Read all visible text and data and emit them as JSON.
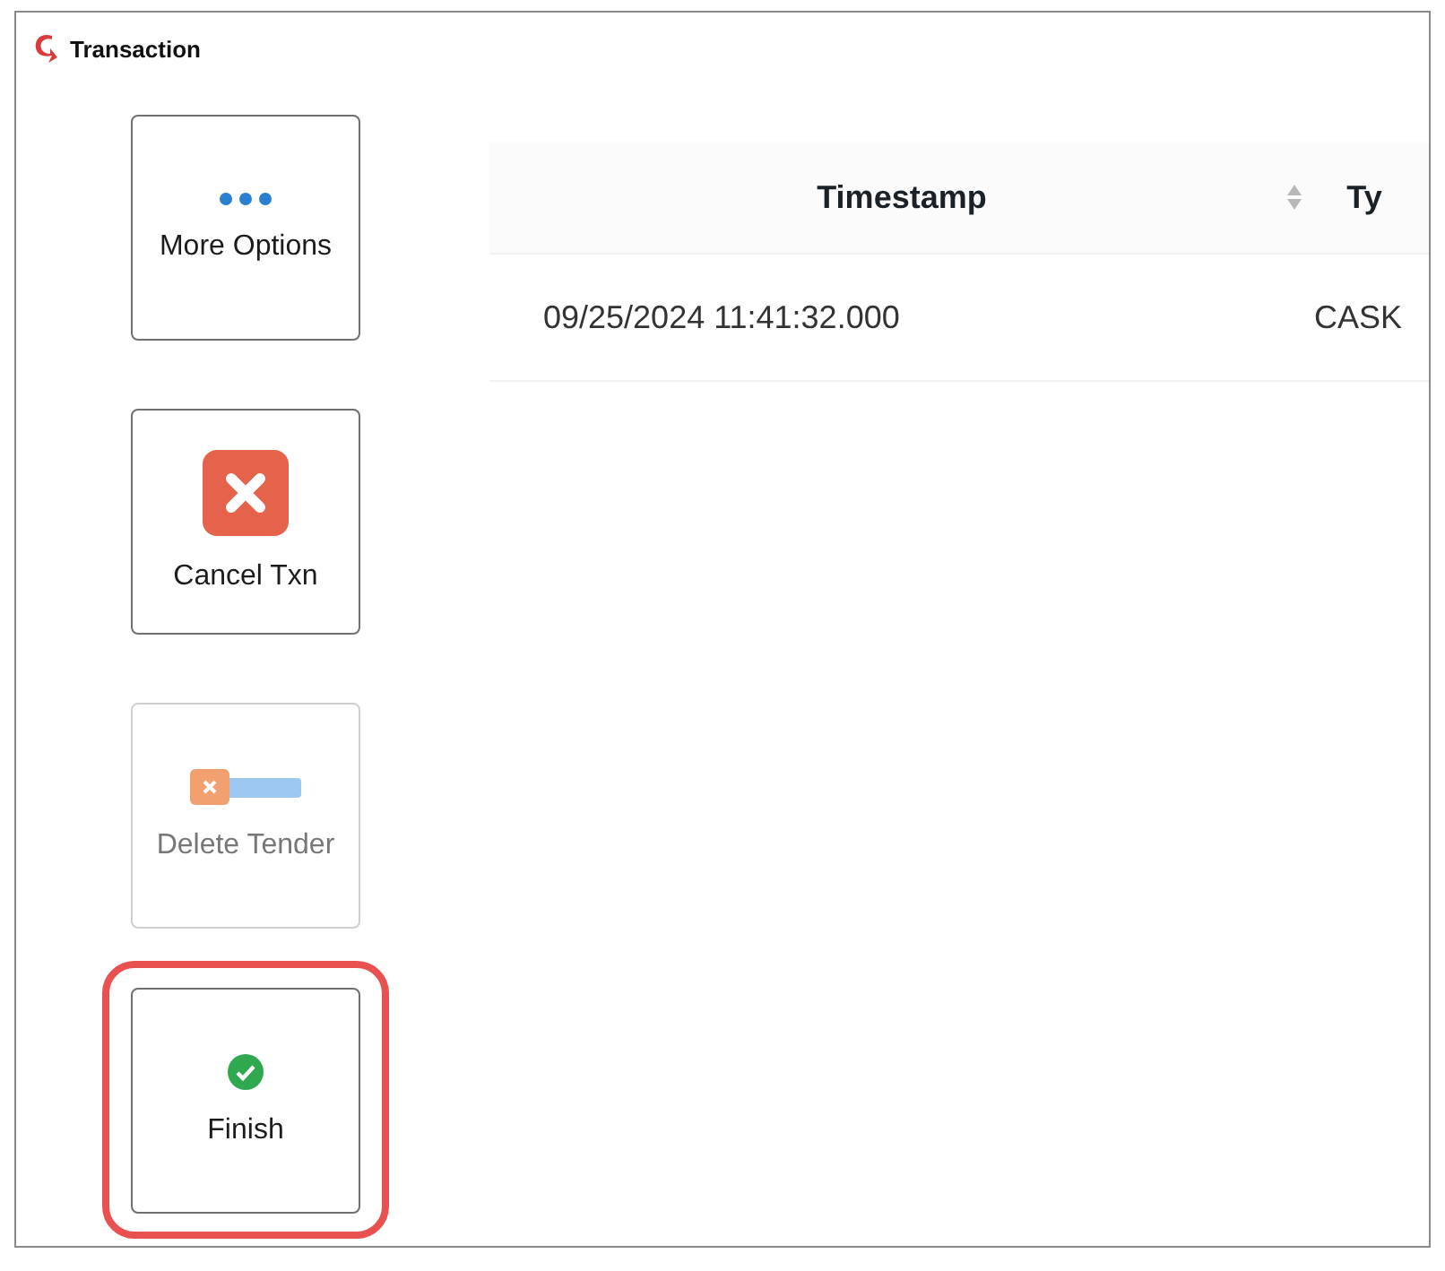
{
  "window": {
    "title": "Transaction"
  },
  "actions": [
    {
      "label": "More Options",
      "kind": "dots",
      "disabled": false,
      "highlighted": false
    },
    {
      "label": "Cancel Txn",
      "kind": "cancel",
      "disabled": false,
      "highlighted": false
    },
    {
      "label": "Delete Tender",
      "kind": "tender",
      "disabled": true,
      "highlighted": false
    },
    {
      "label": "Finish",
      "kind": "check",
      "disabled": false,
      "highlighted": true
    }
  ],
  "table": {
    "columns": [
      {
        "label": "Timestamp",
        "sortable": true
      },
      {
        "label": "Ty"
      }
    ],
    "rows": [
      [
        "09/25/2024 11:41:32.000",
        "CASK"
      ]
    ]
  }
}
